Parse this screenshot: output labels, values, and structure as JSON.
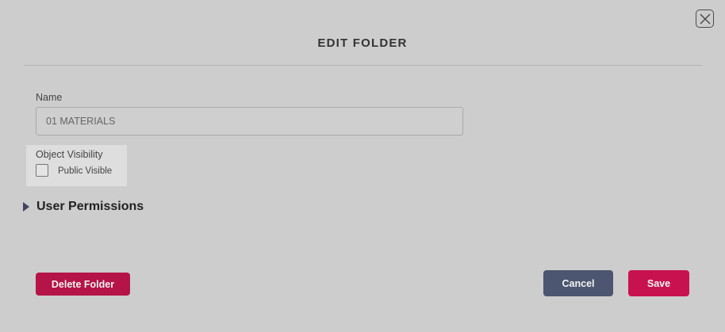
{
  "dialog": {
    "title": "EDIT FOLDER",
    "close_icon": "close-icon"
  },
  "form": {
    "name": {
      "label": "Name",
      "value": "01 MATERIALS"
    },
    "visibility": {
      "label": "Object Visibility",
      "option_label": "Public Visible",
      "checked": false
    },
    "user_permissions": {
      "label": "User Permissions",
      "expanded": false,
      "icon": "caret-right-icon"
    }
  },
  "actions": {
    "delete_label": "Delete Folder",
    "cancel_label": "Cancel",
    "save_label": "Save"
  },
  "colors": {
    "overlay_background": "#cdcdcd",
    "delete_button": "#b51448",
    "cancel_button": "#4c5670",
    "save_button": "#c8124f",
    "caret": "#3f4560"
  }
}
